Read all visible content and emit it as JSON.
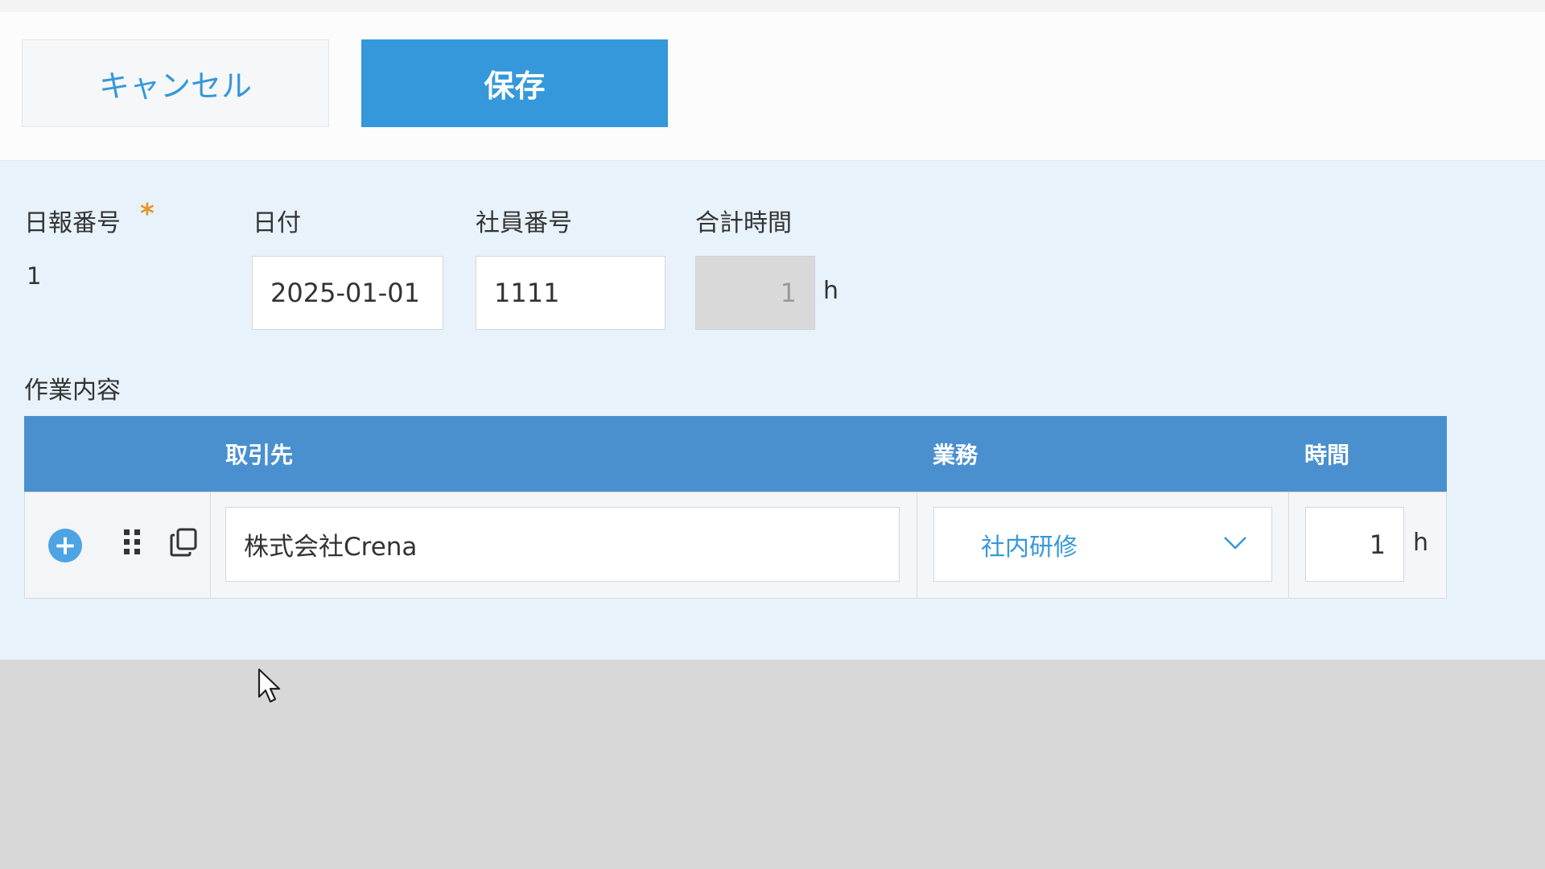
{
  "toolbar": {
    "cancel_label": "キャンセル",
    "save_label": "保存"
  },
  "form": {
    "report_no": {
      "label": "日報番号",
      "required_mark": "*",
      "value": "1"
    },
    "date": {
      "label": "日付",
      "value": "2025-01-01"
    },
    "employee_no": {
      "label": "社員番号",
      "value": "1111"
    },
    "total_hours": {
      "label": "合計時間",
      "value": "1",
      "unit": "h"
    }
  },
  "work": {
    "label": "作業内容",
    "columns": {
      "client": "取引先",
      "task": "業務",
      "hours": "時間"
    },
    "rows": [
      {
        "client": "株式会社Crena",
        "task": "社内研修",
        "hours": "1",
        "unit": "h"
      }
    ]
  },
  "colors": {
    "accent": "#3498db",
    "table_header": "#4a90cf",
    "required": "#e49722",
    "form_background": "#e8f2fa"
  },
  "icons": [
    "add-circle-icon",
    "drag-handle-icon",
    "copy-icon",
    "chevron-down-icon",
    "mouse-cursor-icon"
  ]
}
